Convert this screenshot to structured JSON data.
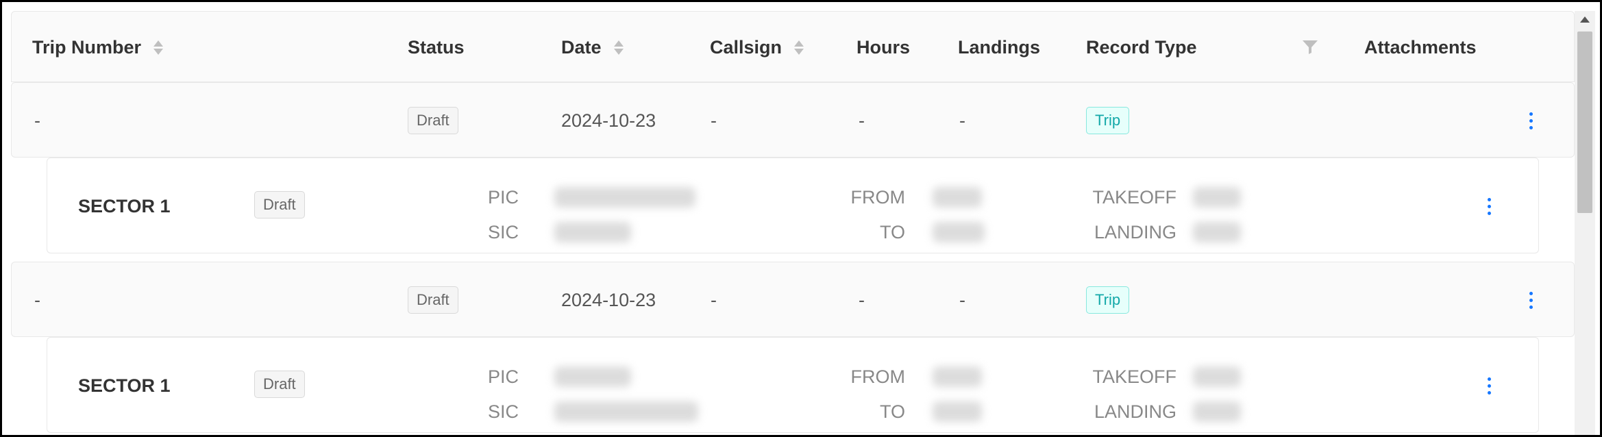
{
  "columns": {
    "trip_number": "Trip Number",
    "status": "Status",
    "date": "Date",
    "callsign": "Callsign",
    "hours": "Hours",
    "landings": "Landings",
    "record_type": "Record Type",
    "attachments": "Attachments"
  },
  "trips": [
    {
      "trip_number": "-",
      "status": "Draft",
      "date": "2024-10-23",
      "callsign": "-",
      "hours": "-",
      "landings": "-",
      "record_type": "Trip",
      "sector": {
        "title": "SECTOR 1",
        "status": "Draft",
        "pic_label": "PIC",
        "sic_label": "SIC",
        "from_label": "FROM",
        "to_label": "TO",
        "takeoff_label": "TAKEOFF",
        "landing_label": "LANDING"
      }
    },
    {
      "trip_number": "-",
      "status": "Draft",
      "date": "2024-10-23",
      "callsign": "-",
      "hours": "-",
      "landings": "-",
      "record_type": "Trip",
      "sector": {
        "title": "SECTOR 1",
        "status": "Draft",
        "pic_label": "PIC",
        "sic_label": "SIC",
        "from_label": "FROM",
        "to_label": "TO",
        "takeoff_label": "TAKEOFF",
        "landing_label": "LANDING"
      }
    }
  ],
  "colors": {
    "accent": "#1677ff",
    "trip_tag": "#13a8a8",
    "draft_tag": "#666666"
  },
  "icons": {
    "sort": "sort-icon",
    "filter": "filter-icon",
    "more": "more-vertical-icon"
  }
}
